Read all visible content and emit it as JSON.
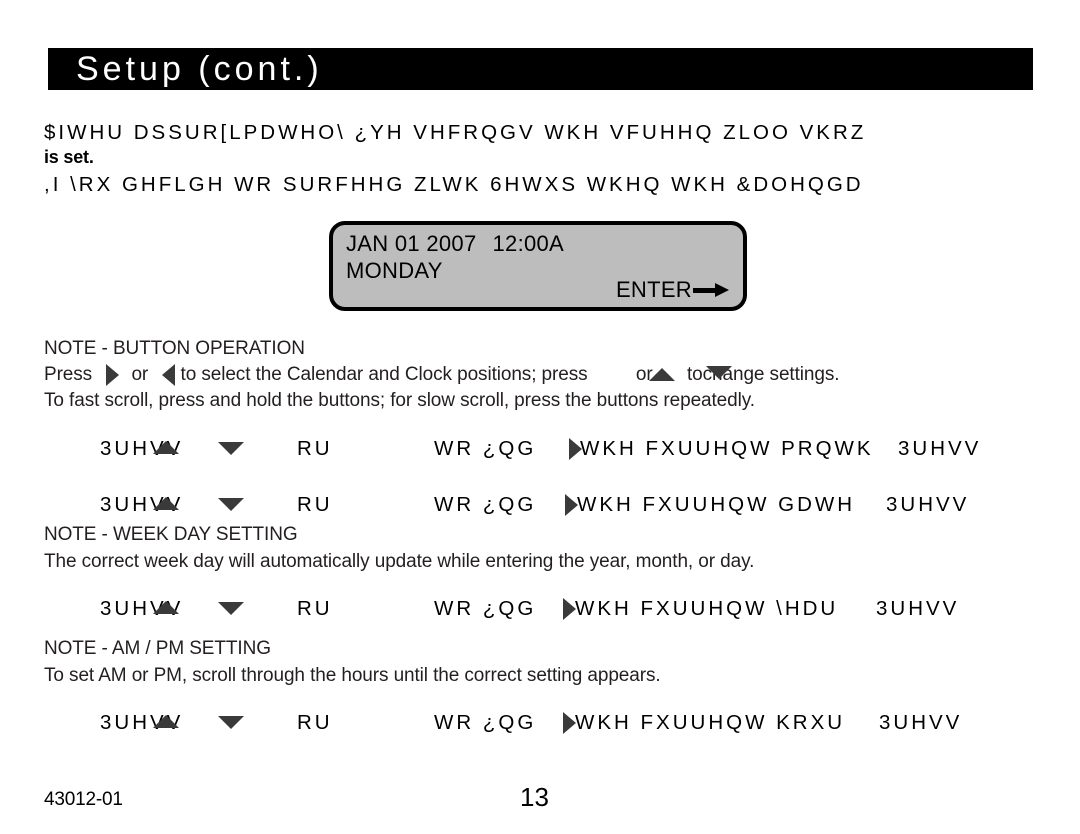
{
  "header": {
    "title": "Setup (cont.)"
  },
  "intro": {
    "line1": "$IWHU DSSUR[LPDWHO\\ ¿YH VHFRQGV WKH VFUHHQ ZLOO VKRZ",
    "line2": "is set.",
    "line3": ",I \\RX GHFLGH WR SURFHHG ZLWK 6HWXS WKHQ WKH &DOHQGD"
  },
  "lcd": {
    "date": "JAN 01 2007",
    "time": "12:00A",
    "weekday": "MONDAY",
    "enter_label": "ENTER",
    "arrow_icon": "arrow-right-icon",
    "background_color": "#bdbdbd",
    "border_color": "#000000"
  },
  "notes": [
    {
      "heading": "NOTE - BUTTON OPERATION",
      "line1_a": "Press",
      "line1_icon1": "triangle-right-icon",
      "line1_b": "or",
      "line1_icon2": "triangle-left-icon",
      "line1_c": "to select the Calendar and Clock positions; press",
      "line1_d": "or",
      "line1_icon3": "triangle-up-icon",
      "line1_e": "to",
      "line1_icon4": "triangle-down-icon",
      "line1_f": "change settings.",
      "line2": "To fast scroll, press and hold the buttons; for slow scroll, press the buttons repeatedly."
    },
    {
      "heading": "NOTE - WEEK DAY SETTING",
      "line1": "The correct week day will automatically update while entering the year, month, or day."
    },
    {
      "heading": "NOTE - AM / PM SETTING",
      "line1": "To set AM or PM, scroll through the hours until the correct setting appears."
    }
  ],
  "instructions": [
    {
      "seg1": "3UHVV",
      "icon1": "triangle-up-icon",
      "icon2": "triangle-down-icon",
      "seg2": "RU",
      "seg3": "WR ¿QG",
      "icon3": "triangle-right-icon",
      "seg4": "WKH FXUUHQW PRQWK",
      "seg5": "3UHVV"
    },
    {
      "seg1": "3UHVV",
      "icon1": "triangle-up-icon",
      "icon2": "triangle-down-icon",
      "seg2": "RU",
      "seg3": "WR ¿QG",
      "icon3": "triangle-right-icon",
      "seg4": "WKH FXUUHQW GDWH",
      "seg5": "3UHVV"
    },
    {
      "seg1": "3UHVV",
      "icon1": "triangle-up-icon",
      "icon2": "triangle-down-icon",
      "seg2": "RU",
      "seg3": "WR ¿QG",
      "icon3": "triangle-right-icon",
      "seg4": "WKH FXUUHQW \\HDU",
      "seg5": "3UHVV"
    },
    {
      "seg1": "3UHVV",
      "icon1": "triangle-up-icon",
      "icon2": "triangle-down-icon",
      "seg2": "RU",
      "seg3": "WR ¿QG",
      "icon3": "triangle-right-icon",
      "seg4": "WKH FXUUHQW KRXU",
      "seg5": "3UHVV"
    }
  ],
  "footer": {
    "document_code": "43012-01",
    "page_number": "13"
  }
}
